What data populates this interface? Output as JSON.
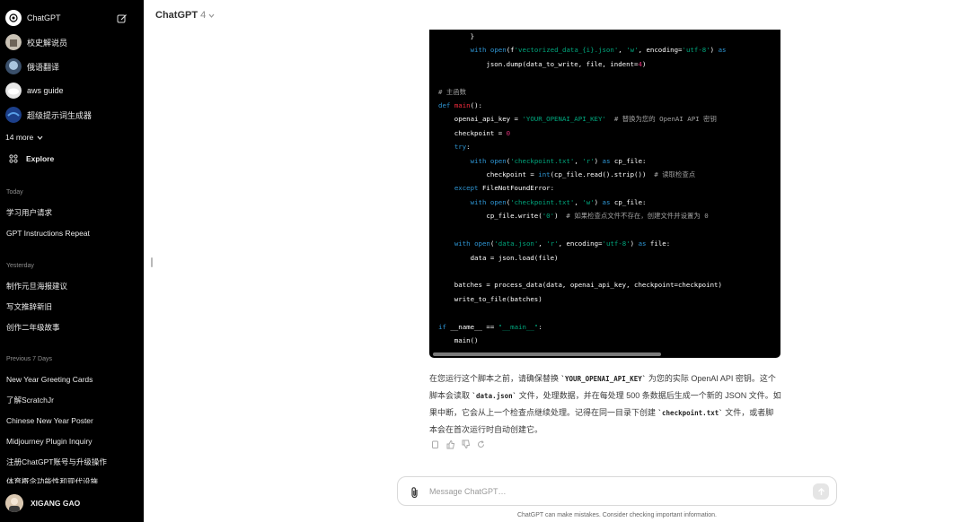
{
  "sidebar": {
    "top_item": "ChatGPT",
    "gpts": [
      {
        "label": "校史解说员",
        "icon": "castle-avatar"
      },
      {
        "label": "俄语翻译",
        "icon": "tree-avatar"
      },
      {
        "label": "aws guide",
        "icon": "cloud-avatar"
      },
      {
        "label": "超级提示词生成器",
        "icon": "earth-avatar"
      }
    ],
    "more_label": "14 more",
    "explore_label": "Explore",
    "sections": [
      {
        "title": "Today",
        "items": [
          "学习用户请求",
          "GPT Instructions Repeat"
        ]
      },
      {
        "title": "Yesterday",
        "items": [
          "制作元旦海报建议",
          "写文推辞新旧",
          "创作二年级故事"
        ]
      },
      {
        "title": "Previous 7 Days",
        "items": [
          "New Year Greeting Cards",
          "了解ScratchJr",
          "Chinese New Year Poster",
          "Midjourney Plugin Inquiry",
          "注册ChatGPT账号与升级操作",
          "体育概念功能性和现代设施"
        ]
      }
    ],
    "user_name": "XIGANG GAO"
  },
  "header": {
    "model_name": "ChatGPT",
    "model_version": "4"
  },
  "code_lines": [
    "        }",
    "        with open(f'vectorized_data_{i}.json', 'w', encoding='utf-8') as",
    "            json.dump(data_to_write, file, indent=4)",
    "",
    "# 主函数",
    "def main():",
    "    openai_api_key = 'YOUR_OPENAI_API_KEY'  # 替换为您的 OpenAI API 密钥",
    "    checkpoint = 0",
    "    try:",
    "        with open('checkpoint.txt', 'r') as cp_file:",
    "            checkpoint = int(cp_file.read().strip())  # 读取检查点",
    "    except FileNotFoundError:",
    "        with open('checkpoint.txt', 'w') as cp_file:",
    "            cp_file.write('0')  # 如果检查点文件不存在，创建文件并设置为 0",
    "",
    "    with open('data.json', 'r', encoding='utf-8') as file:",
    "        data = json.load(file)",
    "",
    "    batches = process_data(data, openai_api_key, checkpoint=checkpoint)",
    "    write_to_file(batches)",
    "",
    "if __name__ == \"__main__\":",
    "    main()"
  ],
  "answer": {
    "p1": "在您运行这个脚本之前，请确保替换 ",
    "c1": "`YOUR_OPENAI_API_KEY`",
    "p2": " 为您的实际 OpenAI API 密钥。这个脚本会读取 ",
    "c2": "`data.json`",
    "p3": " 文件，处理数据，并在每处理 500 条数据后生成一个新的 JSON 文件。如果中断，它会从上一个检查点继续处理。记得在同一目录下创建 ",
    "c3": "`checkpoint.txt`",
    "p4": " 文件，或者脚本会在首次运行时自动创建它。"
  },
  "composer": {
    "placeholder": "Message ChatGPT…",
    "disclaimer": "ChatGPT can make mistakes. Consider checking important information."
  },
  "colors": {
    "sidebar_bg": "#000000",
    "code_bg": "#000000",
    "keyword": "#2e95d3",
    "string": "#00a67d",
    "number": "#df3079"
  }
}
